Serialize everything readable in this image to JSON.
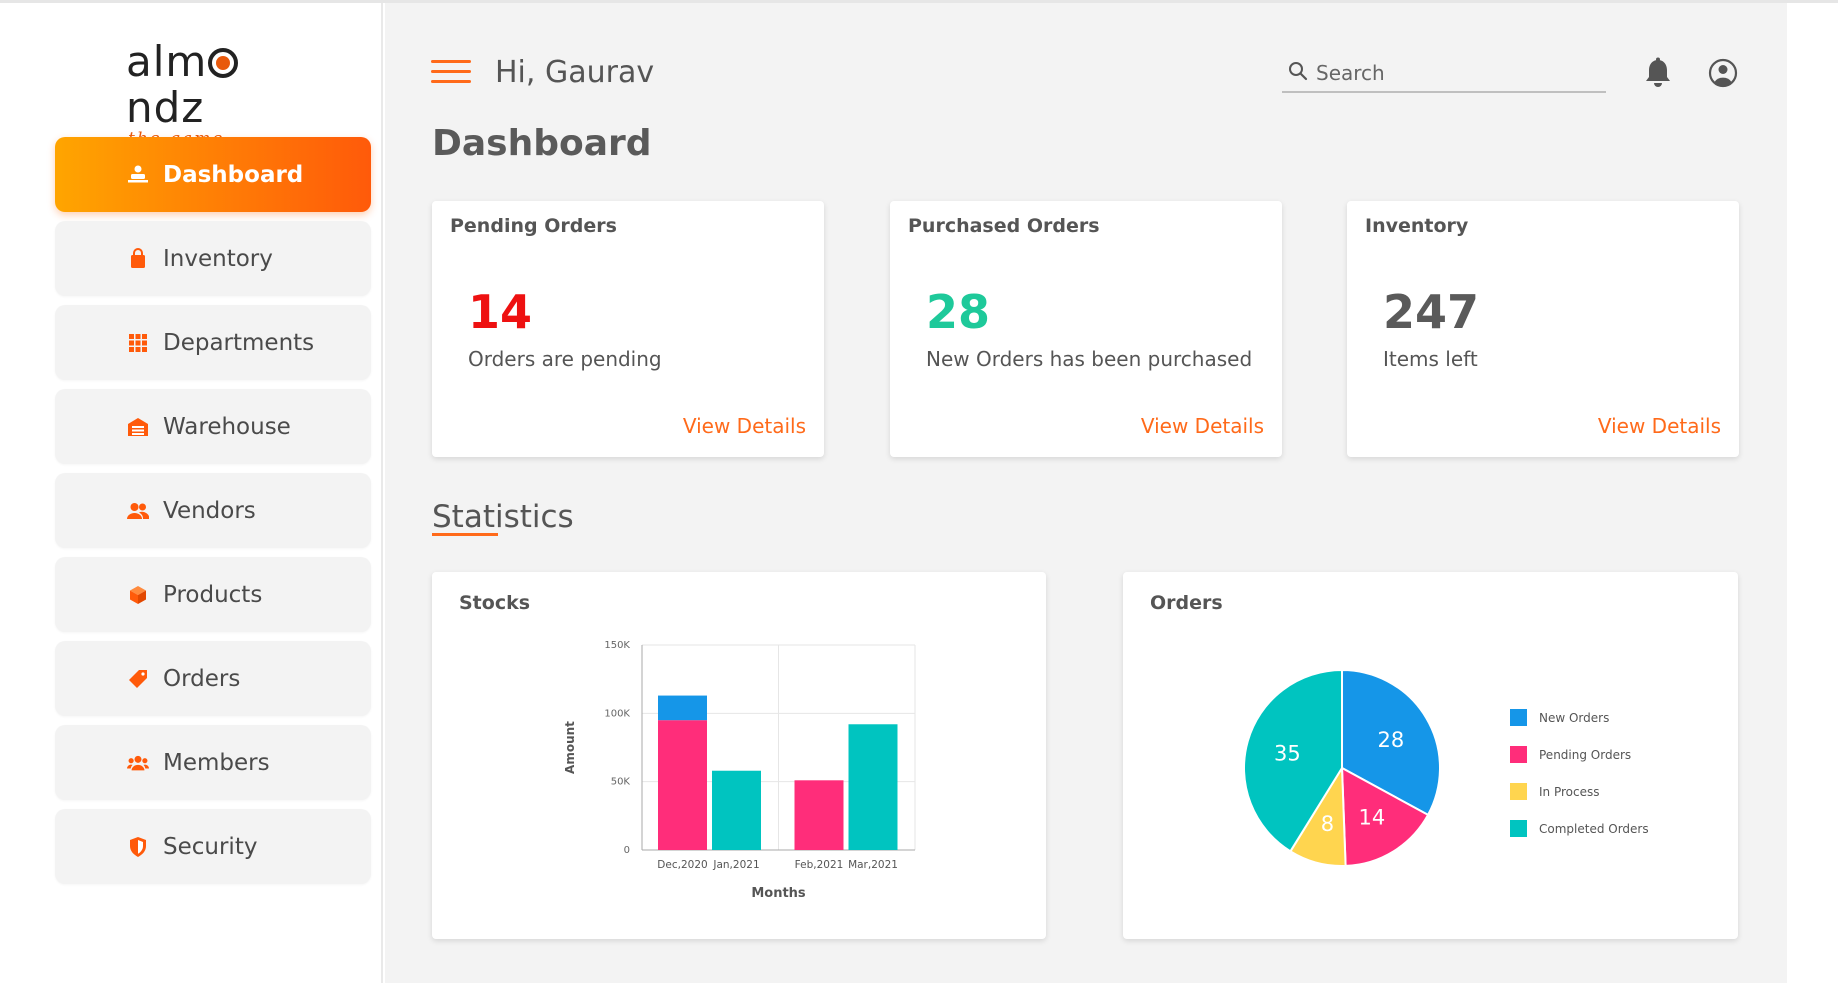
{
  "brand": {
    "name": "almondz",
    "name_pre": "alm",
    "name_post": "ndz",
    "tagline": "the game changer",
    "accent_color": "#e8590c"
  },
  "sidebar": {
    "items": [
      {
        "label": "Dashboard",
        "icon": "dashboard-icon",
        "active": true
      },
      {
        "label": "Inventory",
        "icon": "shopping-bag-icon"
      },
      {
        "label": "Departments",
        "icon": "grid-icon"
      },
      {
        "label": "Warehouse",
        "icon": "warehouse-icon"
      },
      {
        "label": "Vendors",
        "icon": "people-icon"
      },
      {
        "label": "Products",
        "icon": "box-icon"
      },
      {
        "label": "Orders",
        "icon": "tag-icon"
      },
      {
        "label": "Members",
        "icon": "group-icon"
      },
      {
        "label": "Security",
        "icon": "shield-icon"
      }
    ]
  },
  "header": {
    "greeting": "Hi, Gaurav",
    "search_placeholder": "Search"
  },
  "page_title": "Dashboard",
  "summary_cards": [
    {
      "title": "Pending Orders",
      "value": "14",
      "subtitle": "Orders are pending",
      "link": "View Details",
      "value_color": "#ee1111"
    },
    {
      "title": "Purchased Orders",
      "value": "28",
      "subtitle": "New Orders has been purchased",
      "link": "View Details",
      "value_color": "#1ec99a"
    },
    {
      "title": "Inventory",
      "value": "247",
      "subtitle": "Items left",
      "link": "View Details",
      "value_color": "#5a5a5a"
    }
  ],
  "statistics_title": "Statistics",
  "chart_data": [
    {
      "type": "bar",
      "title": "Stocks",
      "xlabel": "Months",
      "ylabel": "Amount",
      "ylim": [
        0,
        150000
      ],
      "yticks": [
        0,
        50000,
        100000,
        150000
      ],
      "ytick_labels": [
        "0",
        "50K",
        "100K",
        "150K"
      ],
      "grid": true,
      "groups": [
        {
          "bars": [
            {
              "label": "Dec,2020",
              "segments": [
                {
                  "value": 95000,
                  "color": "#ff2d7a"
                },
                {
                  "value": 18000,
                  "color": "#1596e8"
                }
              ]
            },
            {
              "label": "Jan,2021",
              "segments": [
                {
                  "value": 58000,
                  "color": "#00c4c0"
                }
              ]
            }
          ]
        },
        {
          "bars": [
            {
              "label": "Feb,2021",
              "segments": [
                {
                  "value": 51000,
                  "color": "#ff2d7a"
                }
              ]
            },
            {
              "label": "Mar,2021",
              "segments": [
                {
                  "value": 92000,
                  "color": "#00c4c0"
                }
              ]
            }
          ]
        }
      ]
    },
    {
      "type": "pie",
      "title": "Orders",
      "legend_position": "right",
      "slices": [
        {
          "name": "New Orders",
          "value": 28,
          "color": "#1596e8"
        },
        {
          "name": "Pending Orders",
          "value": 14,
          "color": "#ff2d7a"
        },
        {
          "name": "In Process",
          "value": 8,
          "color": "#ffd54f"
        },
        {
          "name": "Completed Orders",
          "value": 35,
          "color": "#00c4c0"
        }
      ]
    }
  ]
}
